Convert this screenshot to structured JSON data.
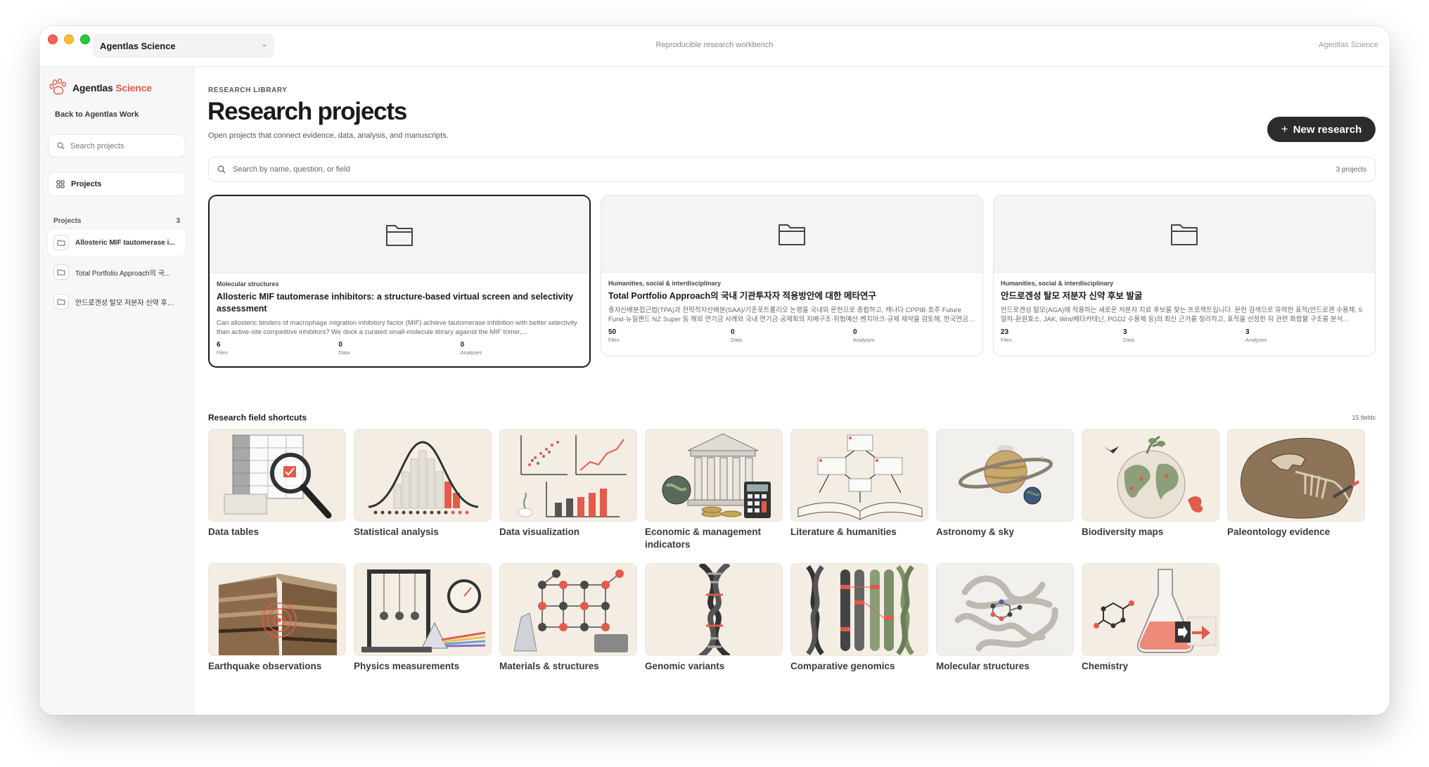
{
  "window": {
    "workspace_name": "Agentlas Science",
    "center_title": "Reproducible research workbench",
    "right_label": "Agentlas Science"
  },
  "sidebar": {
    "brand_main": "Agentlas",
    "brand_accent": "Science",
    "back_link": "Back to Agentlas Work",
    "search_placeholder": "Search projects",
    "projects_button": "Projects",
    "section_label": "Projects",
    "section_count": "3",
    "items": [
      {
        "label": "Allosteric MIF tautomerase i..."
      },
      {
        "label": "Total Portfolio Approach의 국..."
      },
      {
        "label": "안드로겐성 탈모 저분자 신약 후보 ..."
      }
    ]
  },
  "main": {
    "eyebrow": "RESEARCH LIBRARY",
    "title": "Research projects",
    "subtitle": "Open projects that connect evidence, data, analysis, and manuscripts.",
    "new_button": "New research",
    "search_placeholder": "Search by name, question, or field",
    "project_count": "3 projects",
    "cards": [
      {
        "field": "Molecular structures",
        "title": "Allosteric MIF tautomerase inhibitors: a structure-based virtual screen and selectivity assessment",
        "description": "Can allosteric binders of macrophage migration inhibitory factor (MIF) achieve tautomerase inhibition with better selectivity than active-site competitive inhibitors? We dock a curated small-molecule library against the MIF trimer,...",
        "files": "6",
        "data": "0",
        "analyses": "0",
        "files_label": "Files",
        "data_label": "Data",
        "analyses_label": "Analyses"
      },
      {
        "field": "Humanities, social & interdisciplinary",
        "title": "Total Portfolio Approach의 국내 기관투자자 적용방안에 대한 메타연구",
        "description": "총자산배분접근법(TPA)과 전략적자산배분(SAA)/기준포트폴리오 논쟁을 국내외 문헌으로 종합하고, 캐나다 CPPIB·호주 Future Fund·뉴질랜드 NZ Super 등 해외 연기금 사례와 국내 연기금·공제회의 지배구조·위험예산·벤치마크·규제 제약을 검토해, 한국연금학...",
        "files": "50",
        "data": "0",
        "analyses": "0",
        "files_label": "Files",
        "data_label": "Data",
        "analyses_label": "Analyses"
      },
      {
        "field": "Humanities, social & interdisciplinary",
        "title": "안드로겐성 탈모 저분자 신약 후보 발굴",
        "description": "안드로겐성 탈모(AGA)에 적용하는 새로운 저분자 치료 후보를 찾는 프로젝트입니다. 문헌 검색으로 유력한 표적(안드로겐 수용체, 5알파-환원효소, JAK, Wnt/베타카테닌, PGD2 수용체 등)의 최신 근거를 정리하고, 표적을 선정한 뒤 관련 화합물 구조를 분석...",
        "files": "23",
        "data": "3",
        "analyses": "3",
        "files_label": "Files",
        "data_label": "Data",
        "analyses_label": "Analyses"
      }
    ],
    "shortcuts_title": "Research field shortcuts",
    "shortcuts_count": "15 fields",
    "shortcuts": [
      {
        "label": "Data tables",
        "icon": "data-table-magnifier-icon"
      },
      {
        "label": "Statistical analysis",
        "icon": "bell-curve-histogram-icon"
      },
      {
        "label": "Data visualization",
        "icon": "charts-panel-icon"
      },
      {
        "label": "Economic & management indicators",
        "icon": "bank-globe-calculator-icon"
      },
      {
        "label": "Literature & humanities",
        "icon": "open-book-diagram-icon"
      },
      {
        "label": "Astronomy & sky",
        "icon": "saturn-planet-icon"
      },
      {
        "label": "Biodiversity maps",
        "icon": "globe-wildlife-icon"
      },
      {
        "label": "Paleontology evidence",
        "icon": "fossil-rock-icon"
      },
      {
        "label": "Earthquake observations",
        "icon": "earth-layers-fault-icon"
      },
      {
        "label": "Physics measurements",
        "icon": "pendulum-prism-icon"
      },
      {
        "label": "Materials & structures",
        "icon": "crystal-lattice-icon"
      },
      {
        "label": "Genomic variants",
        "icon": "dna-helix-icon"
      },
      {
        "label": "Comparative genomics",
        "icon": "chromosomes-icon"
      },
      {
        "label": "Molecular structures",
        "icon": "protein-ribbon-icon"
      },
      {
        "label": "Chemistry",
        "icon": "flask-molecule-icon"
      }
    ]
  }
}
